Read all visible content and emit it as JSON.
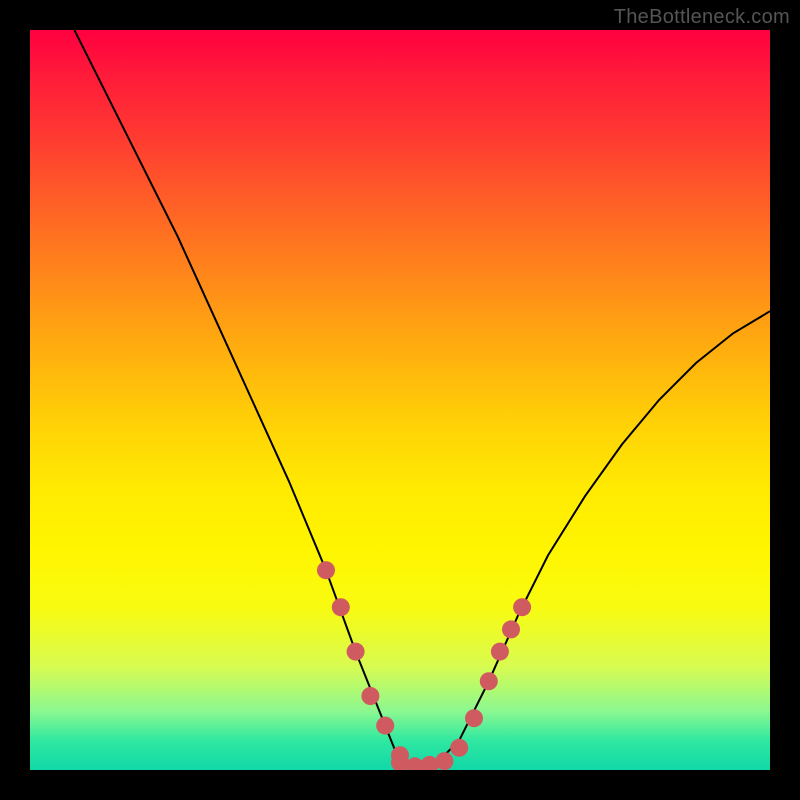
{
  "watermark": "TheBottleneck.com",
  "chart_data": {
    "type": "line",
    "title": "",
    "xlabel": "",
    "ylabel": "",
    "xlim": [
      0,
      100
    ],
    "ylim": [
      0,
      100
    ],
    "curve": {
      "x": [
        6,
        10,
        15,
        20,
        25,
        30,
        35,
        40,
        44,
        48,
        50,
        52,
        55,
        58,
        62,
        66,
        70,
        75,
        80,
        85,
        90,
        95,
        100
      ],
      "y": [
        100,
        92,
        82,
        72,
        61,
        50,
        39,
        27,
        16,
        6,
        1,
        0.5,
        1,
        4,
        12,
        21,
        29,
        37,
        44,
        50,
        55,
        59,
        62
      ]
    },
    "markers": {
      "left": [
        {
          "x": 40,
          "y": 27
        },
        {
          "x": 42,
          "y": 22
        },
        {
          "x": 44,
          "y": 16
        },
        {
          "x": 46,
          "y": 10
        },
        {
          "x": 48,
          "y": 6
        },
        {
          "x": 50,
          "y": 2
        }
      ],
      "right": [
        {
          "x": 62,
          "y": 12
        },
        {
          "x": 63.5,
          "y": 16
        },
        {
          "x": 65,
          "y": 19
        },
        {
          "x": 66.5,
          "y": 22
        }
      ],
      "bottom": [
        {
          "x": 50,
          "y": 1
        },
        {
          "x": 52,
          "y": 0.5
        },
        {
          "x": 54,
          "y": 0.7
        },
        {
          "x": 56,
          "y": 1.2
        },
        {
          "x": 58,
          "y": 3
        },
        {
          "x": 60,
          "y": 7
        }
      ]
    },
    "marker_style": {
      "color": "#cf5a60",
      "radius": 9
    }
  }
}
